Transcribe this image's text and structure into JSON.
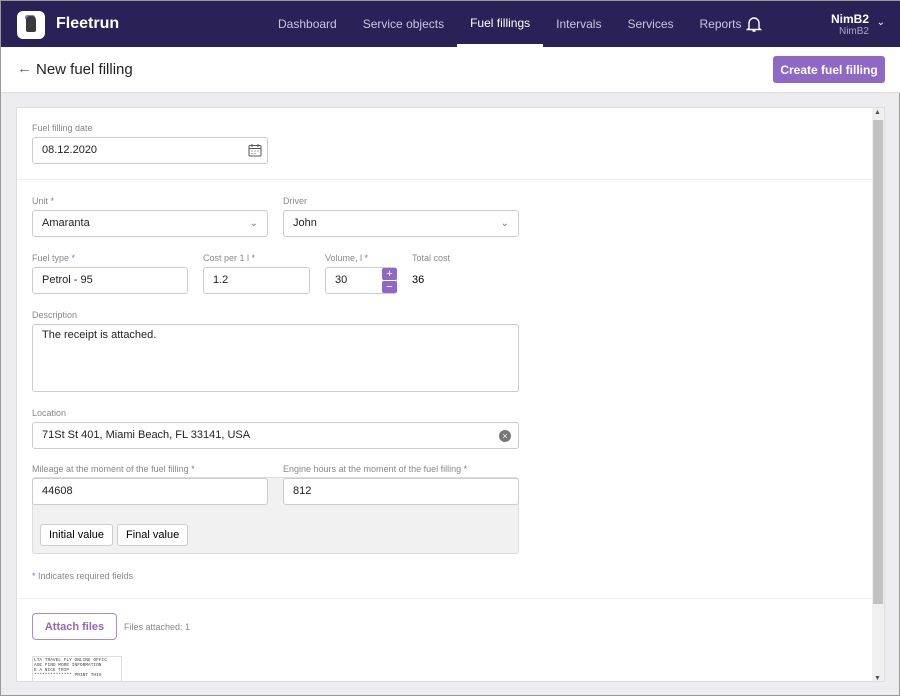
{
  "app": {
    "name": "Fleetrun"
  },
  "nav": [
    "Dashboard",
    "Service objects",
    "Fuel fillings",
    "Intervals",
    "Services",
    "Reports"
  ],
  "user": {
    "name": "NimB2",
    "account": "NimB2"
  },
  "page": {
    "title": "New fuel filling",
    "create_label": "Create fuel filling"
  },
  "form": {
    "date_label": "Fuel filling date",
    "date": "08.12.2020",
    "unit_label": "Unit",
    "unit": "Amaranta",
    "driver_label": "Driver",
    "driver": "John",
    "fuel_type_label": "Fuel type",
    "fuel_type": "Petrol - 95",
    "cost_label": "Cost per 1 l",
    "cost": "1.2",
    "volume_label": "Volume, l",
    "volume": "30",
    "total_label": "Total cost",
    "total": "36",
    "desc_label": "Description",
    "desc": "The receipt is attached.",
    "location_label": "Location",
    "location": "71St St 401, Miami Beach, FL 33141, USA",
    "mileage_label": "Mileage at the moment of the fuel filling",
    "mileage": "44608",
    "engine_label": "Engine hours at the moment of the fuel filling",
    "engine": "812",
    "initial_label": "Initial value",
    "final_label": "Final value",
    "required_note": "Indicates required fields",
    "req": "*"
  },
  "files": {
    "attach_label": "Attach files",
    "count_text": "Files attached: 1",
    "thumb_text": "LTA TRAVEL FLY ONLINE OFFIC\nASE FIND MORE INFORMATION\nE A NICE TRIP\n************** PRINT THIS"
  }
}
